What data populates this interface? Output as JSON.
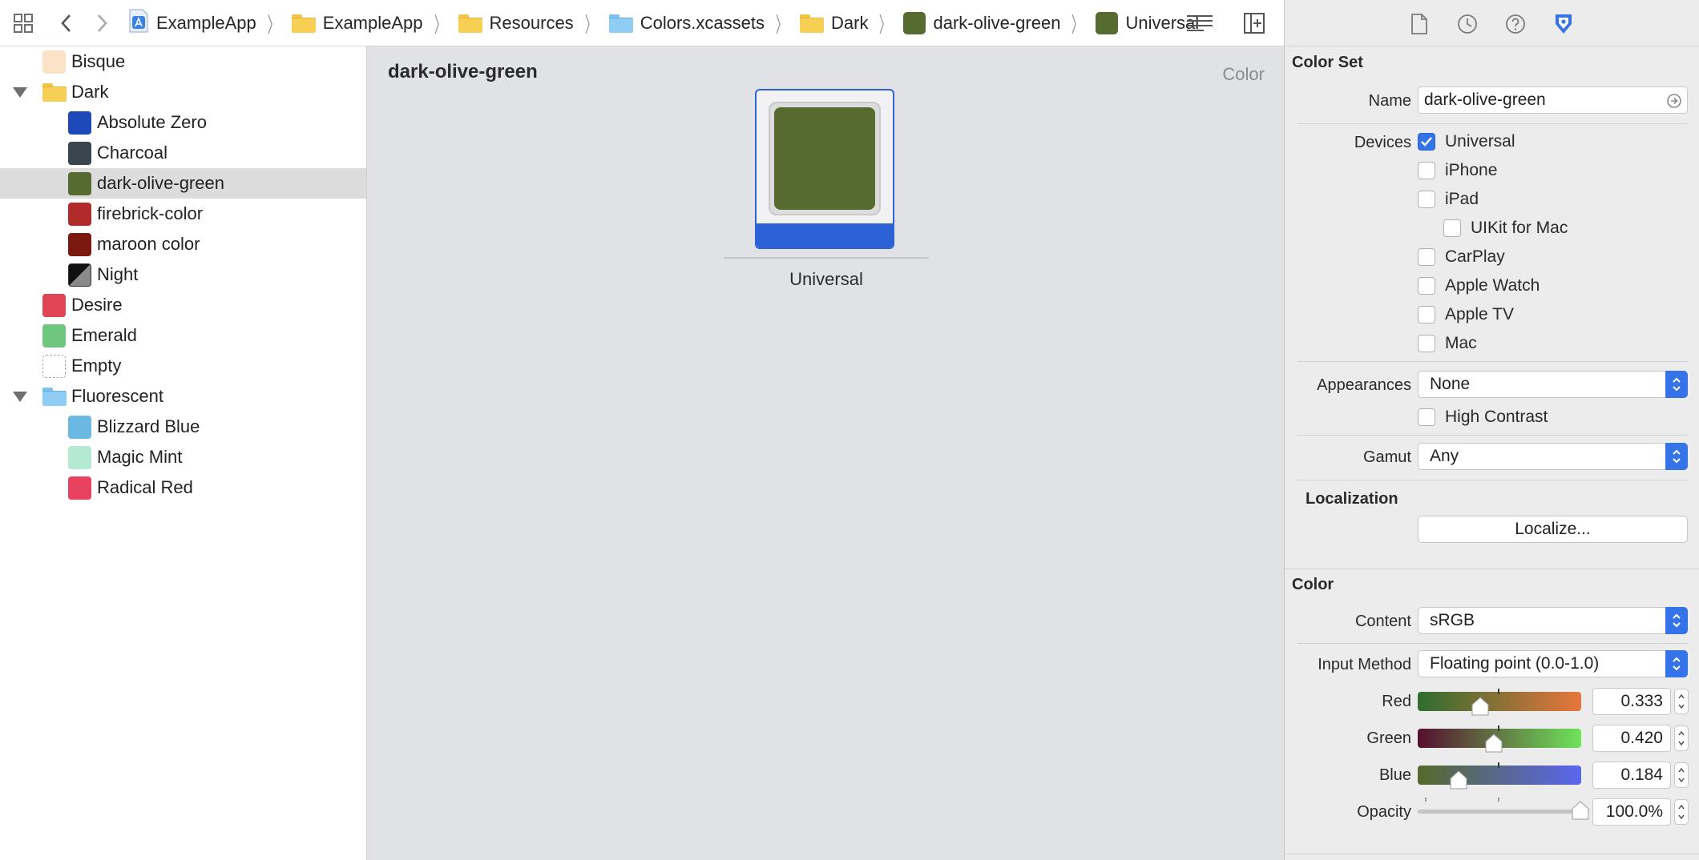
{
  "breadcrumbs": [
    {
      "label": "ExampleApp",
      "icon": "app-project-icon"
    },
    {
      "label": "ExampleApp",
      "icon": "folder-icon"
    },
    {
      "label": "Resources",
      "icon": "folder-icon"
    },
    {
      "label": "Colors.xcassets",
      "icon": "asset-catalog-icon"
    },
    {
      "label": "Dark",
      "icon": "folder-icon"
    },
    {
      "label": "dark-olive-green",
      "icon": "color-swatch-icon"
    },
    {
      "label": "Universal",
      "icon": "color-swatch-icon"
    }
  ],
  "navigator": {
    "items": [
      {
        "label": "Bisque",
        "color": "#fbe3c8"
      },
      {
        "label": "Dark",
        "icon": "folder-icon",
        "expanded": true
      },
      {
        "label": "Absolute Zero",
        "color": "#1e4ab9"
      },
      {
        "label": "Charcoal",
        "color": "#39454f"
      },
      {
        "label": "dark-olive-green",
        "color": "#556b2f",
        "selected": true
      },
      {
        "label": "firebrick-color",
        "color": "#b22b2b"
      },
      {
        "label": "maroon color",
        "color": "#7b1810"
      },
      {
        "label": "Night",
        "icon": "light-dark-split-icon"
      },
      {
        "label": "Desire",
        "color": "#e04555"
      },
      {
        "label": "Emerald",
        "color": "#6fc77e"
      },
      {
        "label": "Empty",
        "icon": "empty-dashed-icon"
      },
      {
        "label": "Fluorescent",
        "icon": "folder-icon",
        "expanded": true
      },
      {
        "label": "Blizzard Blue",
        "color": "#6bb9e3"
      },
      {
        "label": "Magic Mint",
        "color": "#b4ead2"
      },
      {
        "label": "Radical Red",
        "color": "#e9425f"
      }
    ]
  },
  "editor": {
    "title": "dark-olive-green",
    "asset_type": "Color",
    "slot_label": "Universal",
    "slot_color": "#556b2f"
  },
  "inspector": {
    "color_set": {
      "title": "Color Set",
      "name_label": "Name",
      "name_value": "dark-olive-green",
      "devices_label": "Devices",
      "devices": [
        {
          "label": "Universal",
          "checked": true
        },
        {
          "label": "iPhone",
          "checked": false
        },
        {
          "label": "iPad",
          "checked": false
        },
        {
          "label": "UIKit for Mac",
          "checked": false
        },
        {
          "label": "CarPlay",
          "checked": false
        },
        {
          "label": "Apple Watch",
          "checked": false
        },
        {
          "label": "Apple TV",
          "checked": false
        },
        {
          "label": "Mac",
          "checked": false
        }
      ],
      "appearances_label": "Appearances",
      "appearances_value": "None",
      "high_contrast_label": "High Contrast",
      "high_contrast_checked": false,
      "gamut_label": "Gamut",
      "gamut_value": "Any",
      "localization_title": "Localization",
      "localize_button": "Localize..."
    },
    "color": {
      "title": "Color",
      "content_label": "Content",
      "content_value": "sRGB",
      "input_method_label": "Input Method",
      "input_method_value": "Floating point (0.0-1.0)",
      "red_label": "Red",
      "red_value": "0.333",
      "green_label": "Green",
      "green_value": "0.420",
      "blue_label": "Blue",
      "blue_value": "0.184",
      "opacity_label": "Opacity",
      "opacity_value": "100.0%"
    }
  },
  "colors": {
    "accent": "#3574e8",
    "selection_bar": "#2d62d7"
  }
}
